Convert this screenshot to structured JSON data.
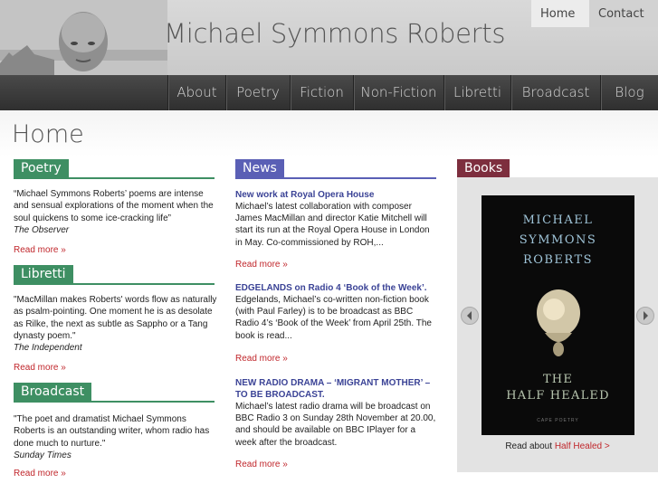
{
  "site": {
    "title": "Michael Symmons Roberts"
  },
  "top_links": [
    {
      "label": "Home"
    },
    {
      "label": "Contact"
    }
  ],
  "nav": [
    {
      "label": "About"
    },
    {
      "label": "Poetry"
    },
    {
      "label": "Fiction"
    },
    {
      "label": "Non-Fiction"
    },
    {
      "label": "Libretti"
    },
    {
      "label": "Broadcast"
    },
    {
      "label": "Blog"
    }
  ],
  "page": {
    "title": "Home"
  },
  "colors": {
    "poetry_green": "#3e8f63",
    "news_blue": "#5a5fb5",
    "books_maroon": "#7d2e3e",
    "link_red": "#c0262b",
    "nav_dark": "#353535"
  },
  "left": {
    "poetry": {
      "heading": "Poetry",
      "quote": "“Michael Symmons Roberts’ poems are intense and sensual explorations of the moment when the soul quickens to some ice-cracking life”",
      "source": "The Observer",
      "read_more": "Read more »"
    },
    "libretti": {
      "heading": "Libretti",
      "quote": "\"MacMillan makes Roberts' words flow as naturally as psalm-pointing. One moment he is as desolate as Rilke, the next as subtle as Sappho or a Tang dynasty poem.\"",
      "source": "The Independent",
      "read_more": "Read more »"
    },
    "broadcast": {
      "heading": "Broadcast",
      "quote": "\"The poet and dramatist Michael Symmons Roberts is an outstanding writer, whom radio has done much to nurture.\"",
      "source": "Sunday Times",
      "read_more": "Read more »"
    }
  },
  "news": {
    "heading": "News",
    "items": [
      {
        "title": "New work at Royal Opera House",
        "body": "Michael’s latest collaboration with composer James MacMillan and director Katie Mitchell will start its run at the Royal Opera House in London in May. Co-commissioned by ROH,...",
        "read_more": "Read more »"
      },
      {
        "title": "EDGELANDS on Radio 4 ‘Book of the Week’.",
        "body": "Edgelands, Michael’s co-written non-fiction book (with Paul Farley) is to be broadcast as BBC Radio 4’s ‘Book of the Week’ from April 25th. The book is read...",
        "read_more": "Read more »"
      },
      {
        "title": "NEW RADIO DRAMA – ‘MIGRANT MOTHER’ – TO BE BROADCAST.",
        "body": "Michael’s latest radio drama will be broadcast on BBC Radio 3 on Sunday 28th November at 20.00, and should be available on BBC IPlayer for a week after the broadcast.",
        "read_more": "Read more »"
      }
    ]
  },
  "books": {
    "heading": "Books",
    "cover": {
      "author_lines": [
        "MICHAEL",
        "SYMMONS",
        "ROBERTS"
      ],
      "title_lines": [
        "THE",
        "HALF HEALED"
      ],
      "imprint": "CAPE POETRY"
    },
    "caption_prefix": "Read about",
    "caption_link": "Half Healed >"
  }
}
